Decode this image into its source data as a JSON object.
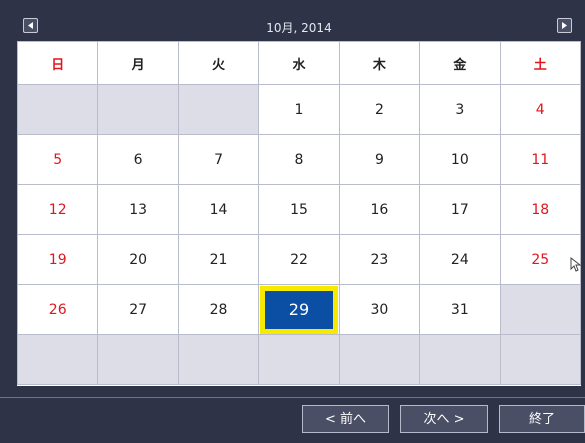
{
  "header": {
    "title": "10月, 2014"
  },
  "weekdays": [
    "日",
    "月",
    "火",
    "水",
    "木",
    "金",
    "土"
  ],
  "weeks": [
    [
      "",
      "",
      "",
      "1",
      "2",
      "3",
      "4"
    ],
    [
      "5",
      "6",
      "7",
      "8",
      "9",
      "10",
      "11"
    ],
    [
      "12",
      "13",
      "14",
      "15",
      "16",
      "17",
      "18"
    ],
    [
      "19",
      "20",
      "21",
      "22",
      "23",
      "24",
      "25"
    ],
    [
      "26",
      "27",
      "28",
      "29",
      "30",
      "31",
      ""
    ],
    [
      "",
      "",
      "",
      "",
      "",
      "",
      ""
    ]
  ],
  "selected_day": "29",
  "footer": {
    "prev_label": "< 前へ",
    "next_label": "次へ >",
    "exit_label": "終了"
  },
  "colors": {
    "weekend": "#e0161f",
    "selected_bg": "#0a4fa3",
    "selected_border": "#f5ea00",
    "empty_cell": "#dcdde6"
  },
  "icons": {
    "prev": "triangle-left-icon",
    "next": "triangle-right-icon",
    "cursor": "mouse-pointer-icon"
  }
}
